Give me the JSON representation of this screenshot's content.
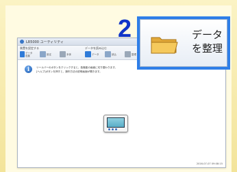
{
  "window": {
    "title": "LR5000 ユーティリティ"
  },
  "toolbar": {
    "group_left": "装置を設定する",
    "group_right": "データを読み込む",
    "buttons": [
      {
        "label": "データ\n収集",
        "color": "#2f7bd8"
      },
      {
        "label": "設定",
        "color": "#8aa6c8"
      },
      {
        "label": "本体",
        "color": "#9aa8b8"
      },
      {
        "label": "データ",
        "color": "#2f7bd8"
      },
      {
        "label": "読込",
        "color": "#8aa6c8"
      },
      {
        "label": "整理",
        "color": "#9aa8b8"
      }
    ]
  },
  "info": {
    "line1": "ツールバーのボタンをクリックすると、各機能の画面に切り替わります。",
    "line2": "[ヘルプ]ボタンを押すと、操作方法の説明画面が開きます。"
  },
  "status": {
    "timestamp": "2016-07-07 09:08:15"
  },
  "callout": {
    "step": "2",
    "text_line1": "データ",
    "text_line2": "を整理",
    "accent": "#2e7ee8"
  }
}
